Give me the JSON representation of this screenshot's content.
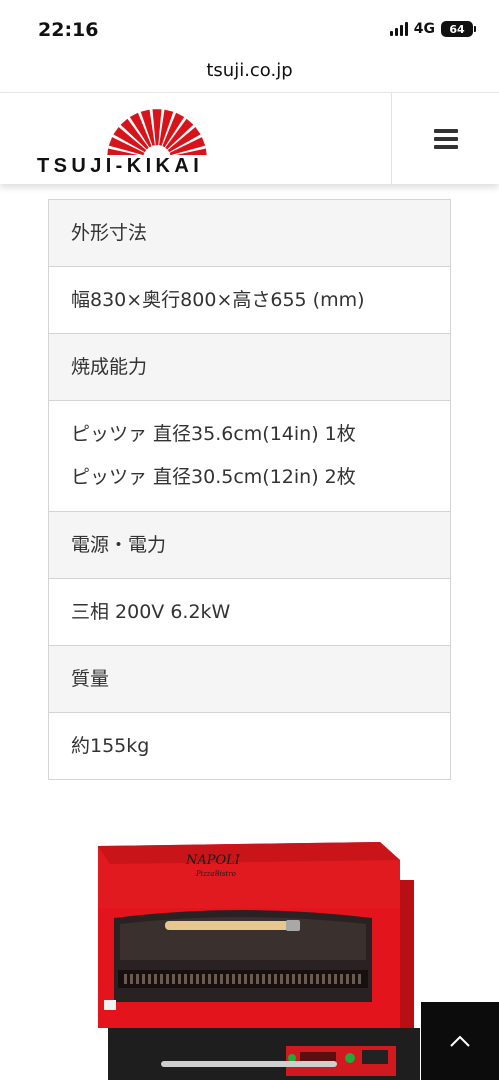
{
  "status_bar": {
    "time": "22:16",
    "network": "4G",
    "battery": "64"
  },
  "browser": {
    "url": "tsuji.co.jp"
  },
  "header": {
    "logo_text": "TSUJI-KIKAI",
    "brand_red": "#d8141b"
  },
  "spec_table": {
    "rows": [
      {
        "type": "head",
        "lines": [
          "外形寸法"
        ]
      },
      {
        "type": "value",
        "lines": [
          "幅830×奥行800×高さ655 (mm)"
        ]
      },
      {
        "type": "head",
        "lines": [
          "焼成能力"
        ]
      },
      {
        "type": "value",
        "lines": [
          "ピッツァ 直径35.6cm(14in) 1枚",
          "ピッツァ 直径30.5cm(12in) 2枚"
        ]
      },
      {
        "type": "head",
        "lines": [
          "電源・電力"
        ]
      },
      {
        "type": "value",
        "lines": [
          "三相 200V 6.2kW"
        ]
      },
      {
        "type": "head",
        "lines": [
          "質量"
        ]
      },
      {
        "type": "value",
        "lines": [
          "約155kg"
        ]
      }
    ]
  },
  "product_image": {
    "brand_text": "NAPOLI",
    "sub_text": "PizzaBistro",
    "body_color": "#e3141b"
  },
  "icons": {
    "menu": "hamburger-icon",
    "scroll_top": "chevron-up-icon"
  }
}
